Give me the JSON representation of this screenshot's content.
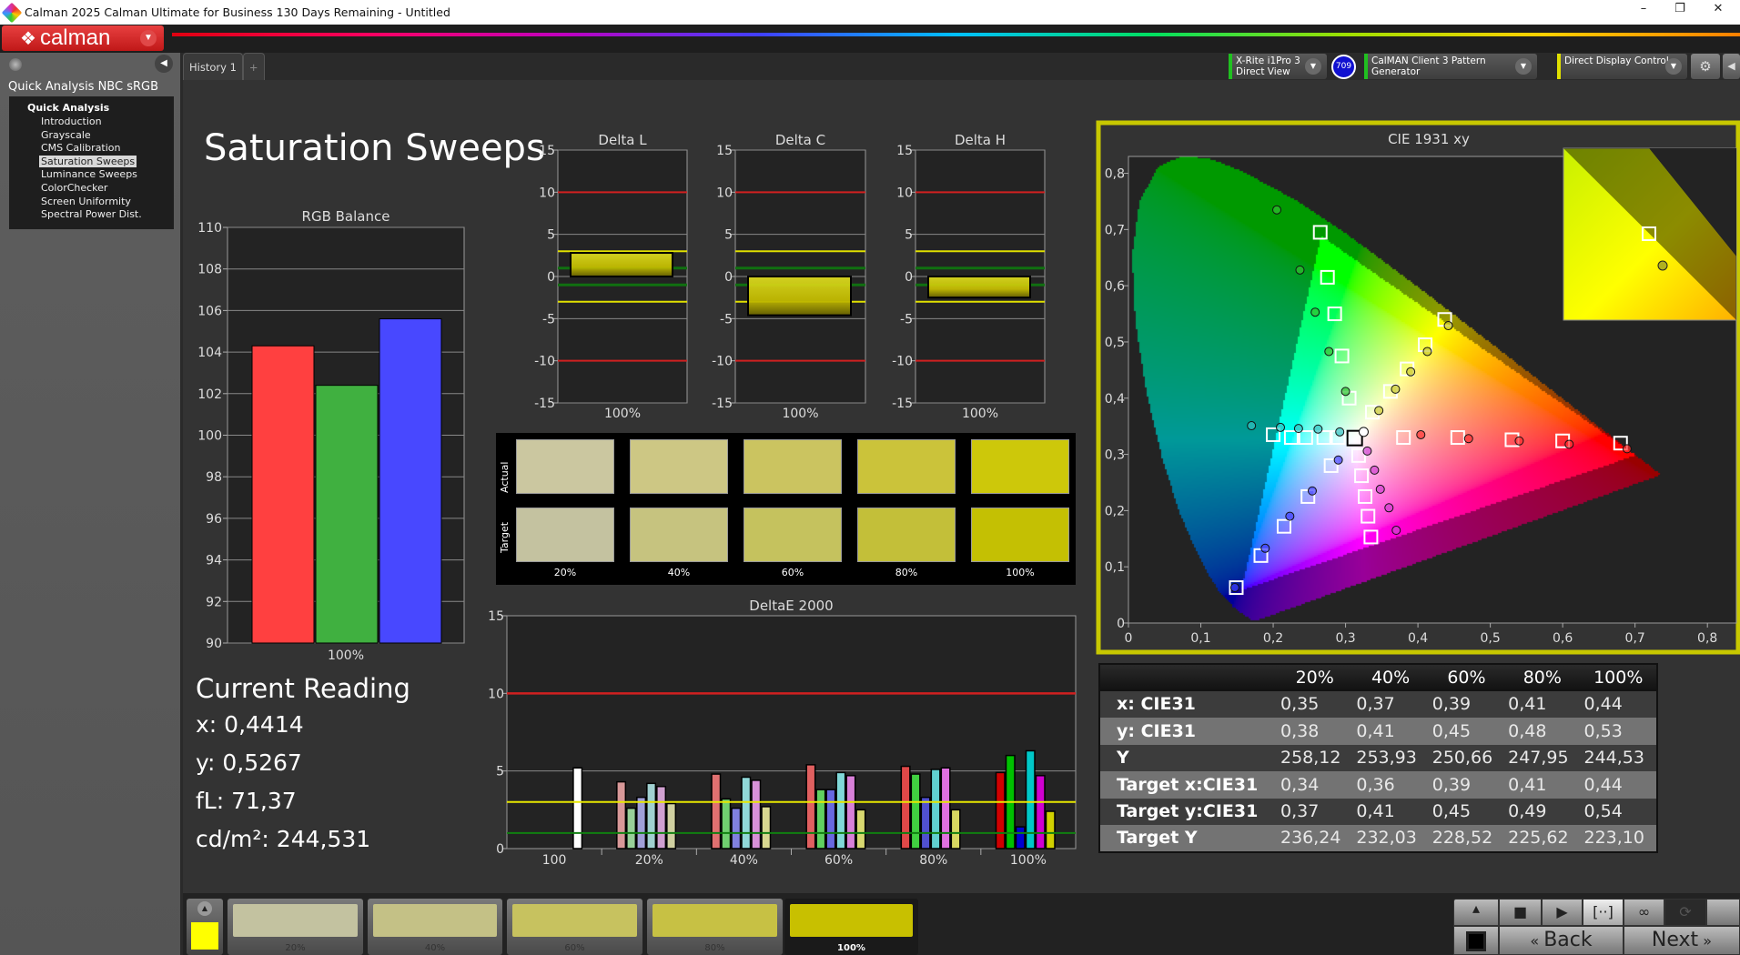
{
  "window": {
    "title": "Calman 2025 Calman Ultimate for Business 130 Days Remaining  - Untitled",
    "minimize": "–",
    "restore": "❐",
    "close": "✕"
  },
  "logo": {
    "text": "calman",
    "menu_icon": "chevron-down-icon"
  },
  "sidebar": {
    "title": "Quick Analysis NBC sRGB",
    "root": "Quick Analysis",
    "items": [
      {
        "label": "Introduction"
      },
      {
        "label": "Grayscale"
      },
      {
        "label": "CMS Calibration"
      },
      {
        "label": "Saturation Sweeps",
        "selected": true
      },
      {
        "label": "Luminance Sweeps"
      },
      {
        "label": "ColorChecker"
      },
      {
        "label": "Screen Uniformity"
      },
      {
        "label": "Spectral Power Dist."
      }
    ]
  },
  "tabs": [
    {
      "label": "History 1"
    },
    {
      "label": "+"
    }
  ],
  "devices": {
    "meter": {
      "line1": "X-Rite i1Pro 3",
      "line2": "Direct View",
      "color": "#20c020"
    },
    "badge": "709",
    "pattern": {
      "label": "CalMAN Client 3 Pattern Generator",
      "color": "#20c020"
    },
    "display": {
      "label": "Direct Display Control",
      "color": "#e0e000"
    }
  },
  "page_title": "Saturation Sweeps",
  "current_reading": {
    "heading": "Current Reading",
    "x": "x: 0,4414",
    "y": "y: 0,5267",
    "fl": "fL: 71,37",
    "cdm2": "cd/m²: 244,531"
  },
  "swatches": {
    "row_labels": [
      "Actual",
      "Target"
    ],
    "labels": [
      "20%",
      "40%",
      "60%",
      "80%",
      "100%"
    ],
    "actual": [
      "#cbc7a0",
      "#cdc784",
      "#cbc460",
      "#cbc33a",
      "#cdc80a"
    ],
    "target": [
      "#c4c2a0",
      "#c6c37f",
      "#c5c25e",
      "#c3bf39",
      "#c4c003"
    ]
  },
  "table": {
    "headers": [
      "",
      "20%",
      "40%",
      "60%",
      "80%",
      "100%"
    ],
    "rows": [
      {
        "label": "x: CIE31",
        "values": [
          "0,35",
          "0,37",
          "0,39",
          "0,41",
          "0,44"
        ]
      },
      {
        "label": "y: CIE31",
        "values": [
          "0,38",
          "0,41",
          "0,45",
          "0,48",
          "0,53"
        ]
      },
      {
        "label": "Y",
        "values": [
          "258,12",
          "253,93",
          "250,66",
          "247,95",
          "244,53"
        ]
      },
      {
        "label": "Target x:CIE31",
        "values": [
          "0,34",
          "0,36",
          "0,39",
          "0,41",
          "0,44"
        ]
      },
      {
        "label": "Target y:CIE31",
        "values": [
          "0,37",
          "0,41",
          "0,45",
          "0,49",
          "0,54"
        ]
      },
      {
        "label": "Target Y",
        "values": [
          "236,24",
          "232,03",
          "228,52",
          "225,62",
          "223,10"
        ]
      }
    ]
  },
  "bottom": {
    "current_color": "#ffff00",
    "swatches": [
      {
        "label": "20%",
        "color": "#c3c2a0"
      },
      {
        "label": "40%",
        "color": "#c4c186"
      },
      {
        "label": "60%",
        "color": "#c7c25f"
      },
      {
        "label": "80%",
        "color": "#c7c144"
      },
      {
        "label": "100%",
        "color": "#c8c000",
        "selected": true
      }
    ],
    "back": "Back",
    "next": "Next"
  },
  "chart_data": [
    {
      "type": "bar",
      "title": "RGB Balance",
      "categories": [
        "100%"
      ],
      "series": [
        {
          "color": "#ff4040",
          "values": [
            104.3
          ]
        },
        {
          "color": "#40b040",
          "values": [
            102.4
          ]
        },
        {
          "color": "#4848ff",
          "values": [
            105.6
          ]
        }
      ],
      "ylim": [
        90,
        110
      ],
      "yticks": [
        90,
        92,
        94,
        96,
        98,
        100,
        102,
        104,
        106,
        108,
        110
      ],
      "grid": true
    },
    {
      "type": "bar",
      "title": "Delta L",
      "categories": [
        "100%"
      ],
      "values": [
        2.8
      ],
      "ylim": [
        -15,
        15
      ],
      "yticks": [
        15,
        10,
        5,
        0,
        -5,
        -10,
        -15
      ],
      "thresholds": {
        "red": 10,
        "yellow": 3,
        "green": 1
      }
    },
    {
      "type": "bar",
      "title": "Delta C",
      "categories": [
        "100%"
      ],
      "values": [
        -4.6
      ],
      "ylim": [
        -15,
        15
      ],
      "yticks": [
        15,
        10,
        5,
        0,
        -5,
        -10,
        -15
      ],
      "thresholds": {
        "red": 10,
        "yellow": 3,
        "green": 1
      }
    },
    {
      "type": "bar",
      "title": "Delta H",
      "categories": [
        "100%"
      ],
      "values": [
        -2.5
      ],
      "ylim": [
        -15,
        15
      ],
      "yticks": [
        15,
        10,
        5,
        0,
        -5,
        -10,
        -15
      ],
      "thresholds": {
        "red": 10,
        "yellow": 3,
        "green": 1
      }
    },
    {
      "type": "bar",
      "title": "DeltaE 2000",
      "categories": [
        "100",
        "20%",
        "40%",
        "60%",
        "80%",
        "100%"
      ],
      "ylim": [
        0,
        15
      ],
      "yticks": [
        0,
        5,
        10,
        15
      ],
      "thresholds": {
        "red": 10,
        "yellow": 3,
        "green": 1
      },
      "groups": [
        {
          "bars": [
            {
              "color": "#ffffff",
              "value": 5.2
            }
          ]
        },
        {
          "bars": [
            {
              "color": "#d89898",
              "value": 4.3
            },
            {
              "color": "#98d098",
              "value": 2.6
            },
            {
              "color": "#a0a0d8",
              "value": 3.3
            },
            {
              "color": "#a0d0d0",
              "value": 4.2
            },
            {
              "color": "#d0a0d0",
              "value": 4.0
            },
            {
              "color": "#d0d0a0",
              "value": 2.9
            }
          ]
        },
        {
          "bars": [
            {
              "color": "#e07070",
              "value": 4.8
            },
            {
              "color": "#70d070",
              "value": 3.2
            },
            {
              "color": "#8080e0",
              "value": 2.6
            },
            {
              "color": "#90d8d8",
              "value": 4.6
            },
            {
              "color": "#d890d8",
              "value": 4.4
            },
            {
              "color": "#d8d890",
              "value": 2.7
            }
          ]
        },
        {
          "bars": [
            {
              "color": "#e06060",
              "value": 5.4
            },
            {
              "color": "#60d060",
              "value": 3.8
            },
            {
              "color": "#6868e0",
              "value": 3.8
            },
            {
              "color": "#80d8d8",
              "value": 4.9
            },
            {
              "color": "#d880d8",
              "value": 4.7
            },
            {
              "color": "#d8d870",
              "value": 2.5
            }
          ]
        },
        {
          "bars": [
            {
              "color": "#e04848",
              "value": 5.3
            },
            {
              "color": "#40d040",
              "value": 4.8
            },
            {
              "color": "#5050d0",
              "value": 3.3
            },
            {
              "color": "#60d0d0",
              "value": 5.1
            },
            {
              "color": "#e070e0",
              "value": 5.2
            },
            {
              "color": "#d8d860",
              "value": 2.5
            }
          ]
        },
        {
          "bars": [
            {
              "color": "#d00000",
              "value": 4.9
            },
            {
              "color": "#00c000",
              "value": 6.0
            },
            {
              "color": "#0000d0",
              "value": 1.4
            },
            {
              "color": "#00c8c8",
              "value": 6.3
            },
            {
              "color": "#d000d0",
              "value": 4.7
            },
            {
              "color": "#d0d000",
              "value": 2.4
            }
          ]
        }
      ]
    },
    {
      "type": "scatter",
      "title": "CIE 1931 xy",
      "xlim": [
        0,
        0.84
      ],
      "ylim": [
        0,
        0.83
      ],
      "xticks": [
        "0",
        "0,1",
        "0,2",
        "0,3",
        "0,4",
        "0,5",
        "0,6",
        "0,7",
        "0,8"
      ],
      "yticks": [
        "0",
        "0,1",
        "0,2",
        "0,3",
        "0,4",
        "0,5",
        "0,6",
        "0,7",
        "0,8"
      ],
      "white": {
        "target": [
          0.3127,
          0.329
        ],
        "measured": [
          0.325,
          0.34
        ]
      },
      "series": [
        {
          "color": "#ff3030",
          "targets": [
            [
              0.38,
              0.33
            ],
            [
              0.455,
              0.33
            ],
            [
              0.53,
              0.326
            ],
            [
              0.6,
              0.324
            ],
            [
              0.68,
              0.32
            ]
          ],
          "measured": [
            [
              0.404,
              0.335
            ],
            [
              0.47,
              0.328
            ],
            [
              0.54,
              0.324
            ],
            [
              0.609,
              0.318
            ],
            [
              0.689,
              0.31
            ]
          ]
        },
        {
          "color": "#30c030",
          "targets": [
            [
              0.305,
              0.4
            ],
            [
              0.295,
              0.475
            ],
            [
              0.285,
              0.55
            ],
            [
              0.275,
              0.615
            ],
            [
              0.265,
              0.695
            ]
          ],
          "measured": [
            [
              0.3,
              0.412
            ],
            [
              0.277,
              0.483
            ],
            [
              0.258,
              0.553
            ],
            [
              0.237,
              0.628
            ],
            [
              0.205,
              0.735
            ]
          ]
        },
        {
          "color": "#4040ff",
          "targets": [
            [
              0.28,
              0.28
            ],
            [
              0.248,
              0.225
            ],
            [
              0.215,
              0.172
            ],
            [
              0.183,
              0.12
            ],
            [
              0.149,
              0.063
            ]
          ],
          "measured": [
            [
              0.29,
              0.29
            ],
            [
              0.254,
              0.235
            ],
            [
              0.223,
              0.19
            ],
            [
              0.189,
              0.133
            ],
            [
              0.147,
              0.063
            ]
          ]
        },
        {
          "color": "#30c0c0",
          "targets": [
            [
              0.29,
              0.33
            ],
            [
              0.27,
              0.33
            ],
            [
              0.245,
              0.33
            ],
            [
              0.225,
              0.33
            ],
            [
              0.2,
              0.335
            ]
          ],
          "measured": [
            [
              0.292,
              0.34
            ],
            [
              0.262,
              0.345
            ],
            [
              0.235,
              0.346
            ],
            [
              0.21,
              0.348
            ],
            [
              0.17,
              0.351
            ]
          ]
        },
        {
          "color": "#d040d0",
          "targets": [
            [
              0.318,
              0.298
            ],
            [
              0.322,
              0.262
            ],
            [
              0.327,
              0.225
            ],
            [
              0.331,
              0.19
            ],
            [
              0.335,
              0.153
            ]
          ],
          "measured": [
            [
              0.33,
              0.306
            ],
            [
              0.34,
              0.272
            ],
            [
              0.348,
              0.238
            ],
            [
              0.36,
              0.205
            ],
            [
              0.37,
              0.165
            ]
          ]
        },
        {
          "color": "#c8c830",
          "targets": [
            [
              0.337,
              0.375
            ],
            [
              0.362,
              0.412
            ],
            [
              0.385,
              0.452
            ],
            [
              0.41,
              0.495
            ],
            [
              0.437,
              0.54
            ]
          ],
          "measured": [
            [
              0.346,
              0.378
            ],
            [
              0.369,
              0.416
            ],
            [
              0.39,
              0.447
            ],
            [
              0.413,
              0.483
            ],
            [
              0.442,
              0.529
            ]
          ]
        }
      ],
      "border_color": "#c8c800"
    }
  ]
}
